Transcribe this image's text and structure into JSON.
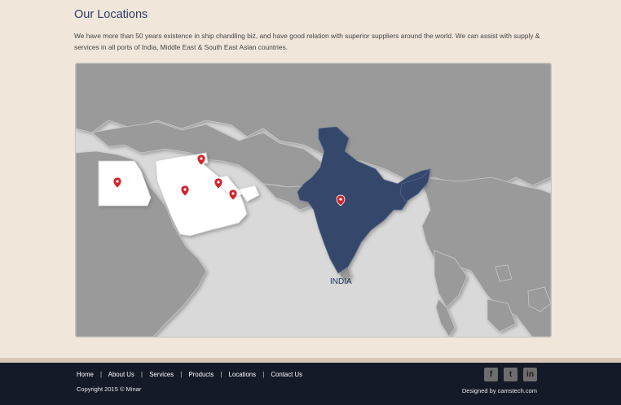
{
  "page": {
    "title": "Our Locations",
    "intro": "We have more than 50 years existence in ship chandling biz, and have good relation with superior suppliers around the world. We can assist with supply & services in all ports of India, Middle East & South East Asian countries."
  },
  "map": {
    "highlight_label": "INDIA",
    "colors": {
      "sea": "#d9d9d9",
      "land": "#9a9a9a",
      "highlight_india": "#34466b",
      "highlight_middle_east": "#ffffff",
      "pin": "#d2232a"
    },
    "pins": [
      "egypt-pin",
      "saudi-arabia-pin",
      "kuwait-pin",
      "qatar-pin",
      "uae-pin",
      "india-pin"
    ]
  },
  "footer": {
    "nav": [
      "Home",
      "About Us",
      "Services",
      "Products",
      "Locations",
      "Contact Us"
    ],
    "separator": "|",
    "copyright": "Copyright 2015 © Minar",
    "credit": "Designed by camstech.com",
    "social": [
      "facebook-icon",
      "twitter-icon",
      "linkedin-icon"
    ],
    "social_glyphs": [
      "f",
      "t",
      "in"
    ]
  }
}
